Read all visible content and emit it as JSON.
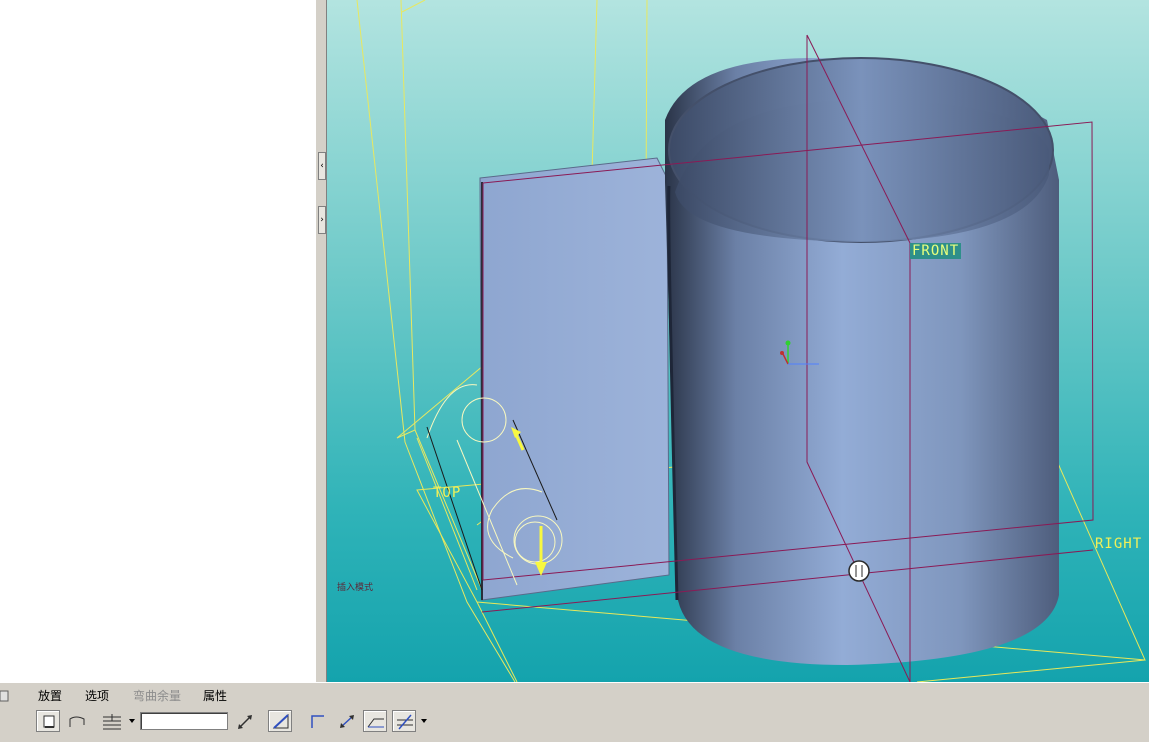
{
  "viewport": {
    "datum_labels": {
      "front": "FRONT",
      "right": "RIGHT",
      "top": "TOP"
    },
    "mode_text": "插入模式",
    "colors": {
      "background_top": "#b3e4e0",
      "background_bottom": "#14a3ad",
      "model": "#8fa8d0",
      "datum_plane_magenta": "#8a1a55",
      "datum_plane_yellow": "#e8e85a",
      "drag_handle": "#f8f840"
    }
  },
  "dashboard": {
    "tabs": [
      {
        "label": "放置",
        "enabled": true
      },
      {
        "label": "选项",
        "enabled": true
      },
      {
        "label": "弯曲余量",
        "enabled": false
      },
      {
        "label": "属性",
        "enabled": true
      }
    ],
    "dimension_value": "",
    "icons": [
      "solid-wall-icon",
      "surface-wall-icon",
      "thickness-icon",
      "dropdown-arrow-icon",
      "flip-thickness-icon",
      "offset-icon",
      "relief-corner-icon",
      "flip-direction-icon",
      "bend-edge-icon",
      "bend-angle-icon",
      "dropdown-arrow-icon"
    ]
  }
}
